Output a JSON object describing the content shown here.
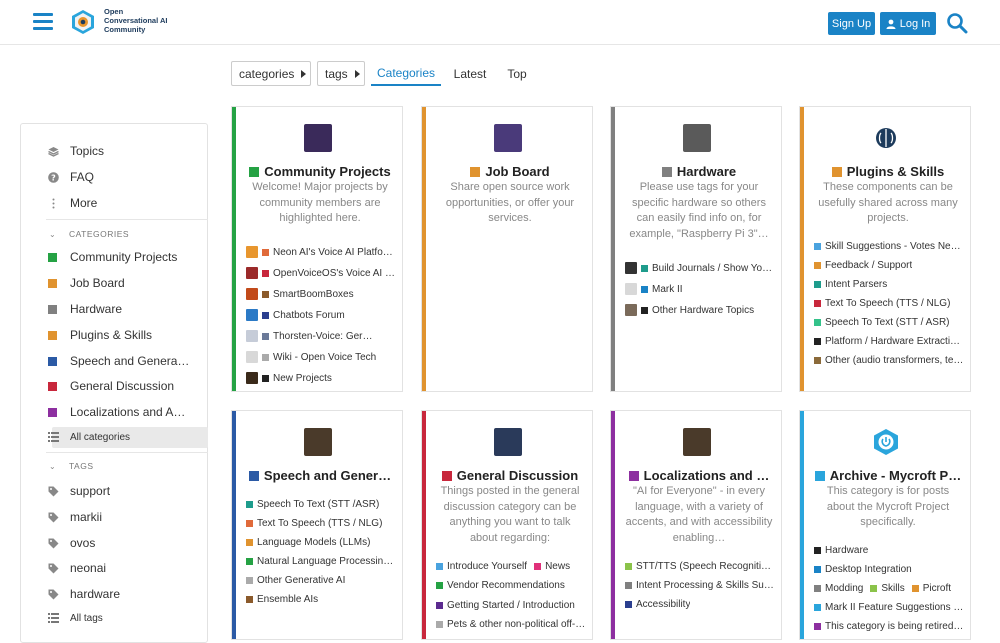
{
  "header": {
    "logo_line1": "Open",
    "logo_line2": "Conversational AI",
    "logo_line3": "Community",
    "signup_label": "Sign Up",
    "login_label": "Log In"
  },
  "nav": {
    "categories_drop": "categories",
    "tags_drop": "tags",
    "tab_categories": "Categories",
    "tab_latest": "Latest",
    "tab_top": "Top"
  },
  "sidebar": {
    "topics": "Topics",
    "faq": "FAQ",
    "more": "More",
    "categories_header": "CATEGORIES",
    "categories": [
      {
        "label": "Community Projects",
        "color": "#25a244"
      },
      {
        "label": "Job Board",
        "color": "#e0932f"
      },
      {
        "label": "Hardware",
        "color": "#808080"
      },
      {
        "label": "Plugins & Skills",
        "color": "#e0932f"
      },
      {
        "label": "Speech and Genera…",
        "color": "#2b5aa5"
      },
      {
        "label": "General Discussion",
        "color": "#c8273c"
      },
      {
        "label": "Localizations and A…",
        "color": "#8d2fa0"
      }
    ],
    "all_categories": "All categories",
    "tags_header": "TAGS",
    "tags": [
      "support",
      "markii",
      "ovos",
      "neonai",
      "hardware"
    ],
    "all_tags": "All tags"
  },
  "cards": [
    {
      "title": "Community Projects",
      "color": "#25a244",
      "desc": "Welcome! Major projects by community members are highlighted here.",
      "subs": [
        {
          "name": "Neon AI's Voice AI Platfor…",
          "color": "#e06a3a",
          "thumb": "#e8962e"
        },
        {
          "name": "OpenVoiceOS's Voice AI …",
          "color": "#c8273c",
          "thumb": "#9b2a2a"
        },
        {
          "name": "SmartBoomBoxes",
          "color": "#8b5a2b",
          "thumb": "#c24a1a"
        },
        {
          "name": "Chatbots Forum",
          "color": "#2b3f8f",
          "thumb": "#2b7ac6"
        },
        {
          "name": "Thorsten-Voice: Ger…",
          "color": "#6b7a99",
          "thumb": "#c6ccd8"
        },
        {
          "name": "Wiki - Open Voice Tech",
          "color": "#aaaaaa",
          "thumb": "#d8d8d8"
        },
        {
          "name": "New Projects",
          "color": "#222222",
          "thumb": "#3a2a1a"
        }
      ]
    },
    {
      "title": "Job Board",
      "color": "#e0932f",
      "desc": "Share open source work opportunities, or offer your services.",
      "subs": []
    },
    {
      "title": "Hardware",
      "color": "#808080",
      "desc": "Please use tags for your specific hardware so others can easily find info on, for example, \"Raspberry Pi 3\"…",
      "subs": [
        {
          "name": "Build Journals / Show You…",
          "color": "#1e9c8c",
          "thumb": "#333333"
        },
        {
          "name": "Mark II",
          "color": "#1a83c6",
          "thumb": "#d8d8d8"
        },
        {
          "name": "Other Hardware Topics",
          "color": "#222222",
          "thumb": "#7a6a5a"
        }
      ]
    },
    {
      "title": "Plugins & Skills",
      "color": "#e0932f",
      "desc": "These components can be usefully shared across many projects.",
      "subs": [
        {
          "name": "Skill Suggestions - Votes Nee…",
          "color": "#4aa3df",
          "thumb": ""
        },
        {
          "name": "Feedback / Support",
          "color": "#e0932f",
          "thumb": ""
        },
        {
          "name": "Intent Parsers",
          "color": "#1e9c8c",
          "thumb": ""
        },
        {
          "name": "Text To Speech (TTS / NLG)",
          "color": "#c8273c",
          "thumb": ""
        },
        {
          "name": "Speech To Text (STT / ASR)",
          "color": "#33c28a",
          "thumb": ""
        },
        {
          "name": "Platform / Hardware Extractio…",
          "color": "#222222",
          "thumb": ""
        },
        {
          "name": "Other (audio transformers, te…",
          "color": "#8b6a3a",
          "thumb": ""
        }
      ]
    },
    {
      "title": "Speech and Gener…",
      "color": "#2b5aa5",
      "desc": "",
      "subs": [
        {
          "name": "Speech To Text (STT /ASR)",
          "color": "#1e9c8c",
          "thumb": ""
        },
        {
          "name": "Text To Speech (TTS / NLG)",
          "color": "#e06a3a",
          "thumb": ""
        },
        {
          "name": "Language Models (LLMs)",
          "color": "#e0932f",
          "thumb": ""
        },
        {
          "name": "Natural Language Processing…",
          "color": "#25a244",
          "thumb": ""
        },
        {
          "name": "Other Generative AI",
          "color": "#aaaaaa",
          "thumb": ""
        },
        {
          "name": "Ensemble AIs",
          "color": "#8b5a2b",
          "thumb": ""
        }
      ]
    },
    {
      "title": "General Discussion",
      "color": "#c8273c",
      "desc": "Things posted in the general discussion category can be anything you want to talk about regarding:",
      "subs": [
        {
          "name": "Introduce Yourself",
          "color": "#4aa3df",
          "thumb": "",
          "extra": "News",
          "extra_color": "#e0307a"
        },
        {
          "name": "Vendor Recommendations",
          "color": "#25a244",
          "thumb": ""
        },
        {
          "name": "Getting Started / Introduction",
          "color": "#5b2a8f",
          "thumb": ""
        },
        {
          "name": "Pets & other non-political off-t…",
          "color": "#aaaaaa",
          "thumb": ""
        }
      ]
    },
    {
      "title": "Localizations and …",
      "color": "#8d2fa0",
      "desc": "\"AI for Everyone\" - in every language, with a variety of accents, and with accessibility enabling…",
      "subs": [
        {
          "name": "STT/TTS (Speech Recognitio…",
          "color": "#8bc34a",
          "thumb": ""
        },
        {
          "name": "Intent Processing & Skills Sup…",
          "color": "#808080",
          "thumb": ""
        },
        {
          "name": "Accessibility",
          "color": "#2b3f8f",
          "thumb": ""
        }
      ]
    },
    {
      "title": "Archive - Mycroft P…",
      "color": "#2aa5dc",
      "desc": "This category is for posts about the Mycroft Project specifically.",
      "subs": [
        {
          "name": "Hardware",
          "color": "#222222",
          "thumb": ""
        },
        {
          "name": "Desktop Integration",
          "color": "#1a83c6",
          "thumb": ""
        },
        {
          "name": "Modding",
          "color": "#808080",
          "thumb": "",
          "extra": "Skills",
          "extra_color": "#8bc34a",
          "extra2": "Picroft",
          "extra2_color": "#e0932f"
        },
        {
          "name": "Mark II Feature Suggestions - …",
          "color": "#2aa5dc",
          "thumb": ""
        },
        {
          "name": "This category is being retired…",
          "color": "#8d2fa0",
          "thumb": ""
        }
      ]
    }
  ]
}
